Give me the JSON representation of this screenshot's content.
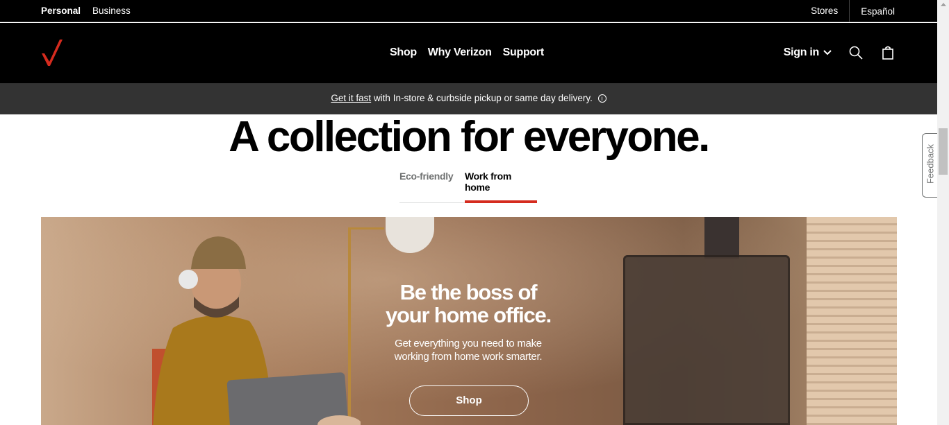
{
  "utility_bar": {
    "personal": "Personal",
    "business": "Business",
    "stores": "Stores",
    "language": "Español"
  },
  "main_nav": {
    "logo_icon": "verizon-check-icon",
    "links": [
      "Shop",
      "Why Verizon",
      "Support"
    ],
    "sign_in": "Sign in",
    "icons": [
      "search-icon",
      "bag-icon"
    ]
  },
  "promo": {
    "link_text": "Get it fast",
    "rest_text": "with In-store & curbside pickup or same day delivery.",
    "info_icon": "info-icon"
  },
  "headline": "A collection for everyone.",
  "tabs": [
    {
      "label": "Eco-friendly",
      "active": false
    },
    {
      "label": "Work from home",
      "active": true
    }
  ],
  "hero": {
    "title_line1": "Be the boss of",
    "title_line2": "your home office.",
    "subtitle_line1": "Get everything you need to make",
    "subtitle_line2": "working from home work smarter.",
    "button_label": "Shop"
  },
  "feedback_label": "Feedback",
  "colors": {
    "brand_red": "#d52b1e",
    "nav_bg": "#000000",
    "promo_bg": "#333333"
  }
}
